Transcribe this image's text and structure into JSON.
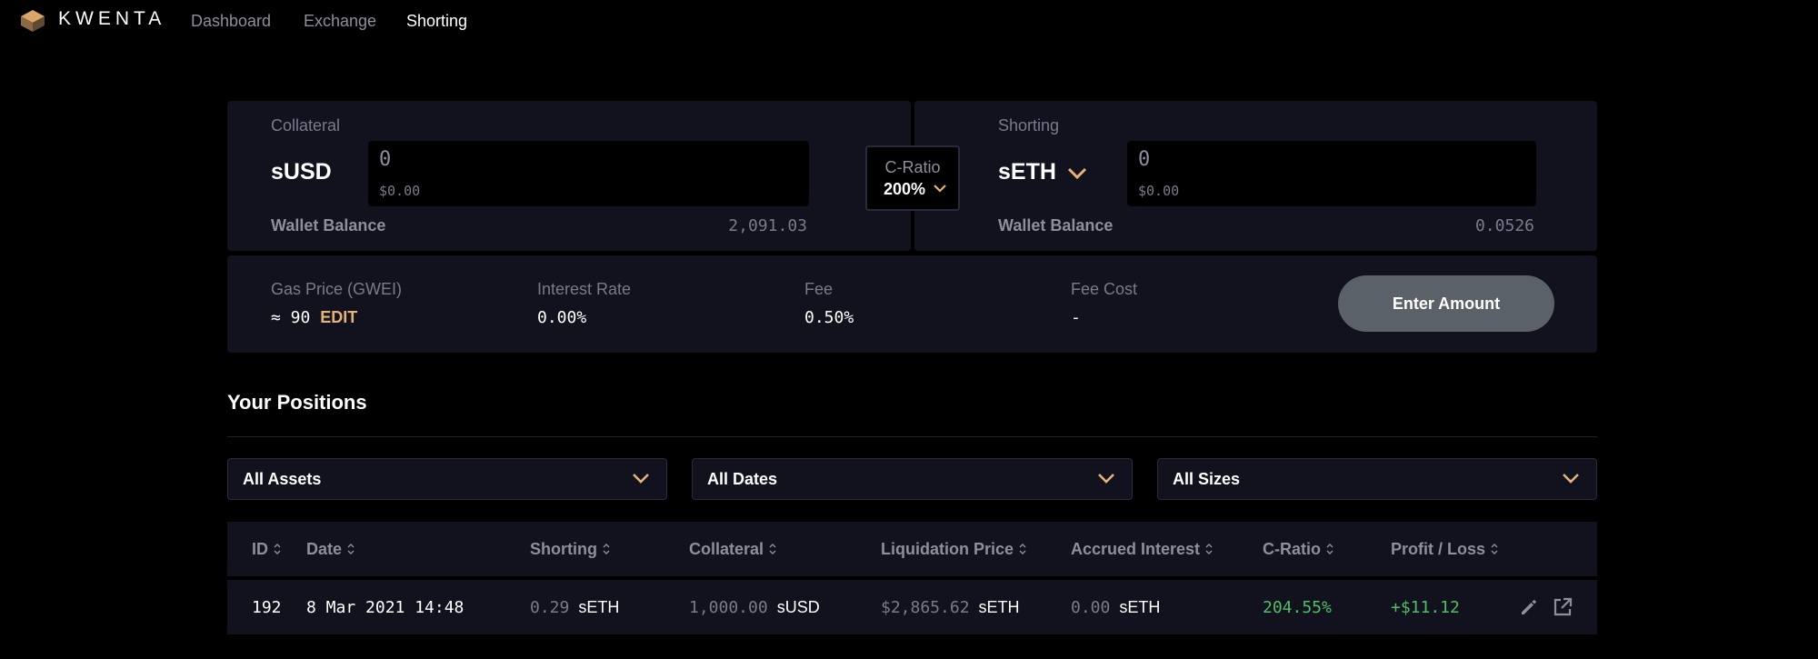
{
  "nav": {
    "brand": "KWENTA",
    "links": [
      "Dashboard",
      "Exchange",
      "Shorting"
    ],
    "active": "Shorting"
  },
  "collateral": {
    "label": "Collateral",
    "asset": "sUSD",
    "amount_placeholder": "0",
    "usd_value": "$0.00",
    "wallet_label": "Wallet Balance",
    "wallet_balance": "2,091.03"
  },
  "cratio_selector": {
    "label": "C-Ratio",
    "value": "200%"
  },
  "shorting": {
    "label": "Shorting",
    "asset": "sETH",
    "amount_placeholder": "0",
    "usd_value": "$0.00",
    "wallet_label": "Wallet Balance",
    "wallet_balance": "0.0526"
  },
  "info": {
    "gas_label": "Gas Price (GWEI)",
    "gas_value": "≈ 90",
    "gas_edit": "EDIT",
    "interest_label": "Interest Rate",
    "interest_value": "0.00%",
    "fee_label": "Fee",
    "fee_value": "0.50%",
    "fee_cost_label": "Fee Cost",
    "fee_cost_value": "-",
    "submit_label": "Enter Amount"
  },
  "positions": {
    "title": "Your Positions",
    "filters": [
      "All Assets",
      "All Dates",
      "All Sizes"
    ],
    "columns": [
      "ID",
      "Date",
      "Shorting",
      "Collateral",
      "Liquidation Price",
      "Accrued Interest",
      "C-Ratio",
      "Profit / Loss"
    ],
    "rows": [
      {
        "id": "192",
        "date": "8 Mar 2021 14:48",
        "shorting_amount": "0.29",
        "shorting_asset": "sETH",
        "collateral_amount": "1,000.00",
        "collateral_asset": "sUSD",
        "liq_price": "$2,865.62",
        "liq_asset": "sETH",
        "interest_amount": "0.00",
        "interest_asset": "sETH",
        "cratio": "204.55%",
        "pnl": "+$11.12"
      }
    ]
  },
  "colors": {
    "background": "#000000",
    "panel": "#12121e",
    "accent": "#e4b378",
    "positive": "#4fbf67",
    "muted": "#7a7a8c",
    "button": "#5a6168"
  },
  "icons": [
    "kwenta-logo-icon",
    "chevron-down-icon",
    "sort-icon",
    "edit-pencil-icon",
    "external-link-icon"
  ]
}
